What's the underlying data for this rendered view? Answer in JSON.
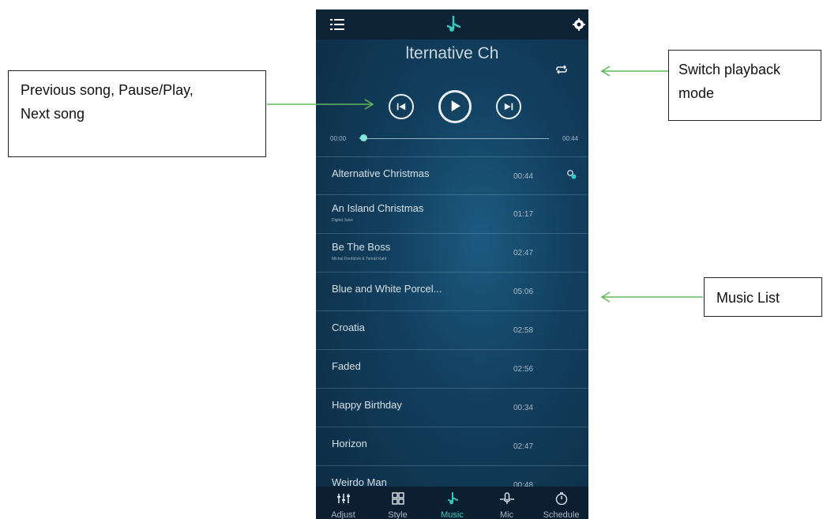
{
  "header": {
    "menu_icon": "menu-icon",
    "logo_icon": "music-note-icon",
    "settings_icon": "gear-icon"
  },
  "player": {
    "now_playing_title": "lternative Ch",
    "playback_mode_icon": "repeat-icon",
    "previous_icon": "skip-previous-icon",
    "play_icon": "play-icon",
    "next_icon": "skip-next-icon",
    "time_current": "00:00",
    "time_total": "00:44",
    "progress": 0.02,
    "accent_color": "#35c9bf"
  },
  "songs": [
    {
      "title": "Alternative Christmas",
      "artist": "",
      "duration": "00:44",
      "playing": true
    },
    {
      "title": "An Island Christmas",
      "artist": "Digital Juice",
      "duration": "01:17"
    },
    {
      "title": "Be The Boss",
      "artist": "Michal Dvořáček & Tomáš Kahl",
      "duration": "02:47"
    },
    {
      "title": "Blue and White Porcel...",
      "artist": "",
      "duration": "05:06"
    },
    {
      "title": "Croatia",
      "artist": "",
      "duration": "02:58"
    },
    {
      "title": "Faded",
      "artist": "",
      "duration": "02:56"
    },
    {
      "title": "Happy Birthday",
      "artist": "",
      "duration": "00:34"
    },
    {
      "title": "Horizon",
      "artist": "",
      "duration": "02:47"
    },
    {
      "title": "Weirdo Man",
      "artist": "",
      "duration": "00:48"
    }
  ],
  "tabs": [
    {
      "label": "Adjust",
      "icon": "sliders-icon",
      "active": false
    },
    {
      "label": "Style",
      "icon": "grid-icon",
      "active": false
    },
    {
      "label": "Music",
      "icon": "music-note-icon",
      "active": true
    },
    {
      "label": "Mic",
      "icon": "microphone-icon",
      "active": false
    },
    {
      "label": "Schedule",
      "icon": "timer-icon",
      "active": false
    }
  ],
  "callouts": {
    "controls_line1": "Previous song, Pause/Play,",
    "controls_line2": "Next song",
    "mode_line1": "Switch playback",
    "mode_line2": "mode",
    "list": "Music List",
    "arrow_color": "#5fb85a"
  }
}
